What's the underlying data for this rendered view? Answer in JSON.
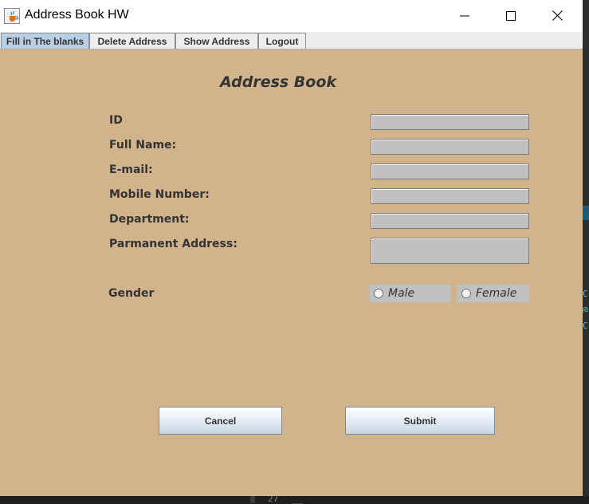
{
  "window": {
    "title": "Address Book HW",
    "icon": "java-cup-icon",
    "controls": [
      "minimize-icon",
      "maximize-icon",
      "close-icon"
    ]
  },
  "tabs": [
    {
      "label": "Fill in The blanks",
      "selected": true
    },
    {
      "label": "Delete Address",
      "selected": false
    },
    {
      "label": "Show Address",
      "selected": false
    },
    {
      "label": "Logout",
      "selected": false
    }
  ],
  "form": {
    "title": "Address Book",
    "fields": [
      {
        "label": "ID",
        "value": ""
      },
      {
        "label": "Full Name:",
        "value": ""
      },
      {
        "label": "E-mail:",
        "value": ""
      },
      {
        "label": "Mobile Number:",
        "value": ""
      },
      {
        "label": "Department:",
        "value": ""
      },
      {
        "label": "Parmanent Address:",
        "value": ""
      }
    ],
    "gender": {
      "label": "Gender",
      "options": [
        "Male",
        "Female"
      ],
      "selected": null
    },
    "buttons": {
      "cancel": "Cancel",
      "submit": "Submit"
    }
  },
  "background": {
    "line_numbers": [
      "27",
      "__"
    ]
  },
  "colors": {
    "panel_bg": "#d2b48c",
    "field_bg": "#c0c0c0",
    "selected_tab": "#b8cfe5",
    "text": "#333333"
  }
}
